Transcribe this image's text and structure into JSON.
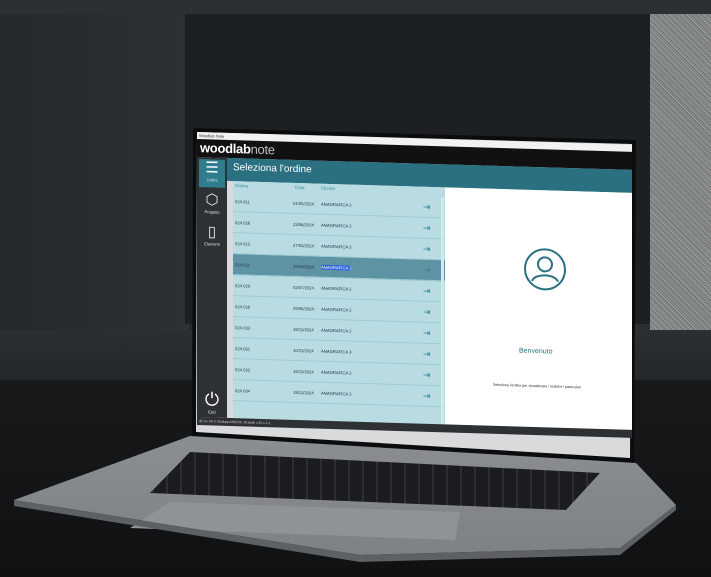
{
  "window": {
    "title": "Woodlab Note"
  },
  "brand": {
    "name_bold": "woodlab",
    "name_light": "note"
  },
  "sidebar": {
    "items": [
      {
        "label": "Ordini",
        "icon": "menu-icon"
      },
      {
        "label": "Progetto",
        "icon": "cube-icon"
      },
      {
        "label": "Elementi",
        "icon": "cabinet-icon"
      }
    ],
    "power": {
      "label": "Esci",
      "icon": "power-icon"
    }
  },
  "page": {
    "title": "Seleziona l'ordine"
  },
  "table": {
    "columns": [
      "Ordine",
      "Data",
      "Cliente"
    ],
    "rows": [
      {
        "ordine": "024.011",
        "data": "01/05/2024",
        "cliente": "ANAGRAFICA 3"
      },
      {
        "ordine": "024.026",
        "data": "23/06/2024",
        "cliente": "ANAGRAFICA 2"
      },
      {
        "ordine": "024.013",
        "data": "27/03/2024",
        "cliente": "ANAGRAFICA 3"
      },
      {
        "ordine": "024.021",
        "data": "25/04/2024",
        "cliente": "ANAGRAFICA 2",
        "selected": true
      },
      {
        "ordine": "024.029",
        "data": "02/07/2024",
        "cliente": "ANAGRAFICA 2"
      },
      {
        "ordine": "024.028",
        "data": "25/06/2024",
        "cliente": "ANAGRAFICA 2"
      },
      {
        "ordine": "024.033",
        "data": "18/11/2024",
        "cliente": "ANAGRAFICA 2"
      },
      {
        "ordine": "024.031",
        "data": "10/11/2024",
        "cliente": "ANAGRAFICA 3"
      },
      {
        "ordine": "024.032",
        "data": "19/11/2024",
        "cliente": "ANAGRAFICA 2"
      },
      {
        "ordine": "024.034",
        "data": "19/11/2024",
        "cliente": "ANAGRAFICA 3"
      }
    ]
  },
  "welcome": {
    "title": "Benvenuto",
    "hint": "Seleziona l'ordine per visualizzare i mobili e i particolari"
  },
  "status": {
    "text": "@ srv-09 C:\\Sviluppo\\DEV\\0_W.xpdb v.25.1.2.1"
  },
  "colors": {
    "accent": "#2b7080",
    "list_bg": "#b9dce3",
    "selection": "#2d63d6"
  }
}
